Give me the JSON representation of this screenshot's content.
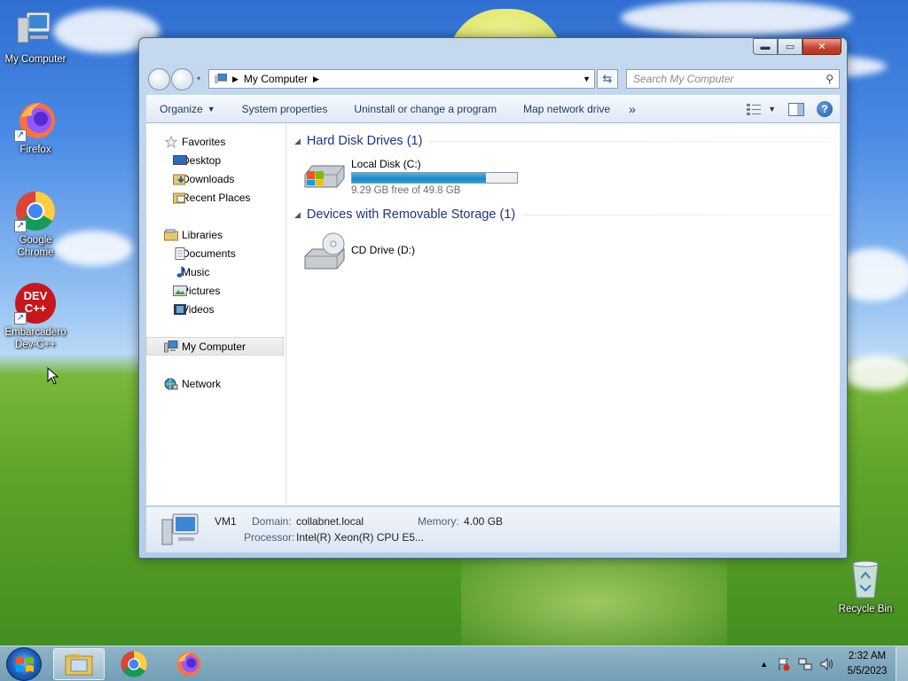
{
  "desktop": {
    "icons": [
      {
        "label": "My Computer"
      },
      {
        "label": "Firefox"
      },
      {
        "label": "Google Chrome"
      },
      {
        "label": "Embarcadero Dev-C++"
      },
      {
        "label": "Recycle Bin"
      }
    ],
    "devcpp_badge": "DEV C++"
  },
  "window": {
    "address": {
      "crumb": "My Computer"
    },
    "search": {
      "placeholder": "Search My Computer"
    },
    "toolbar": {
      "organize": "Organize",
      "system_properties": "System properties",
      "uninstall": "Uninstall or change a program",
      "map_drive": "Map network drive",
      "more": "»"
    },
    "nav": {
      "favorites": "Favorites",
      "desktop": "Desktop",
      "downloads": "Downloads",
      "recent": "Recent Places",
      "libraries": "Libraries",
      "documents": "Documents",
      "music": "Music",
      "pictures": "Pictures",
      "videos": "Videos",
      "computer": "My Computer",
      "network": "Network"
    },
    "groups": {
      "hdd_title": "Hard Disk Drives (1)",
      "removable_title": "Devices with Removable Storage (1)"
    },
    "drives": {
      "c": {
        "name": "Local Disk (C:)",
        "free_text": "9.29 GB free of 49.8 GB",
        "used_fraction": 0.813
      },
      "d": {
        "name": "CD Drive (D:)"
      }
    },
    "details": {
      "computer_name": "VM1",
      "domain_label": "Domain:",
      "domain_value": "collabnet.local",
      "memory_label": "Memory:",
      "memory_value": "4.00 GB",
      "processor_label": "Processor:",
      "processor_value": "Intel(R) Xeon(R) CPU E5..."
    }
  },
  "taskbar": {
    "time": "2:32 AM",
    "date": "5/5/2023"
  }
}
